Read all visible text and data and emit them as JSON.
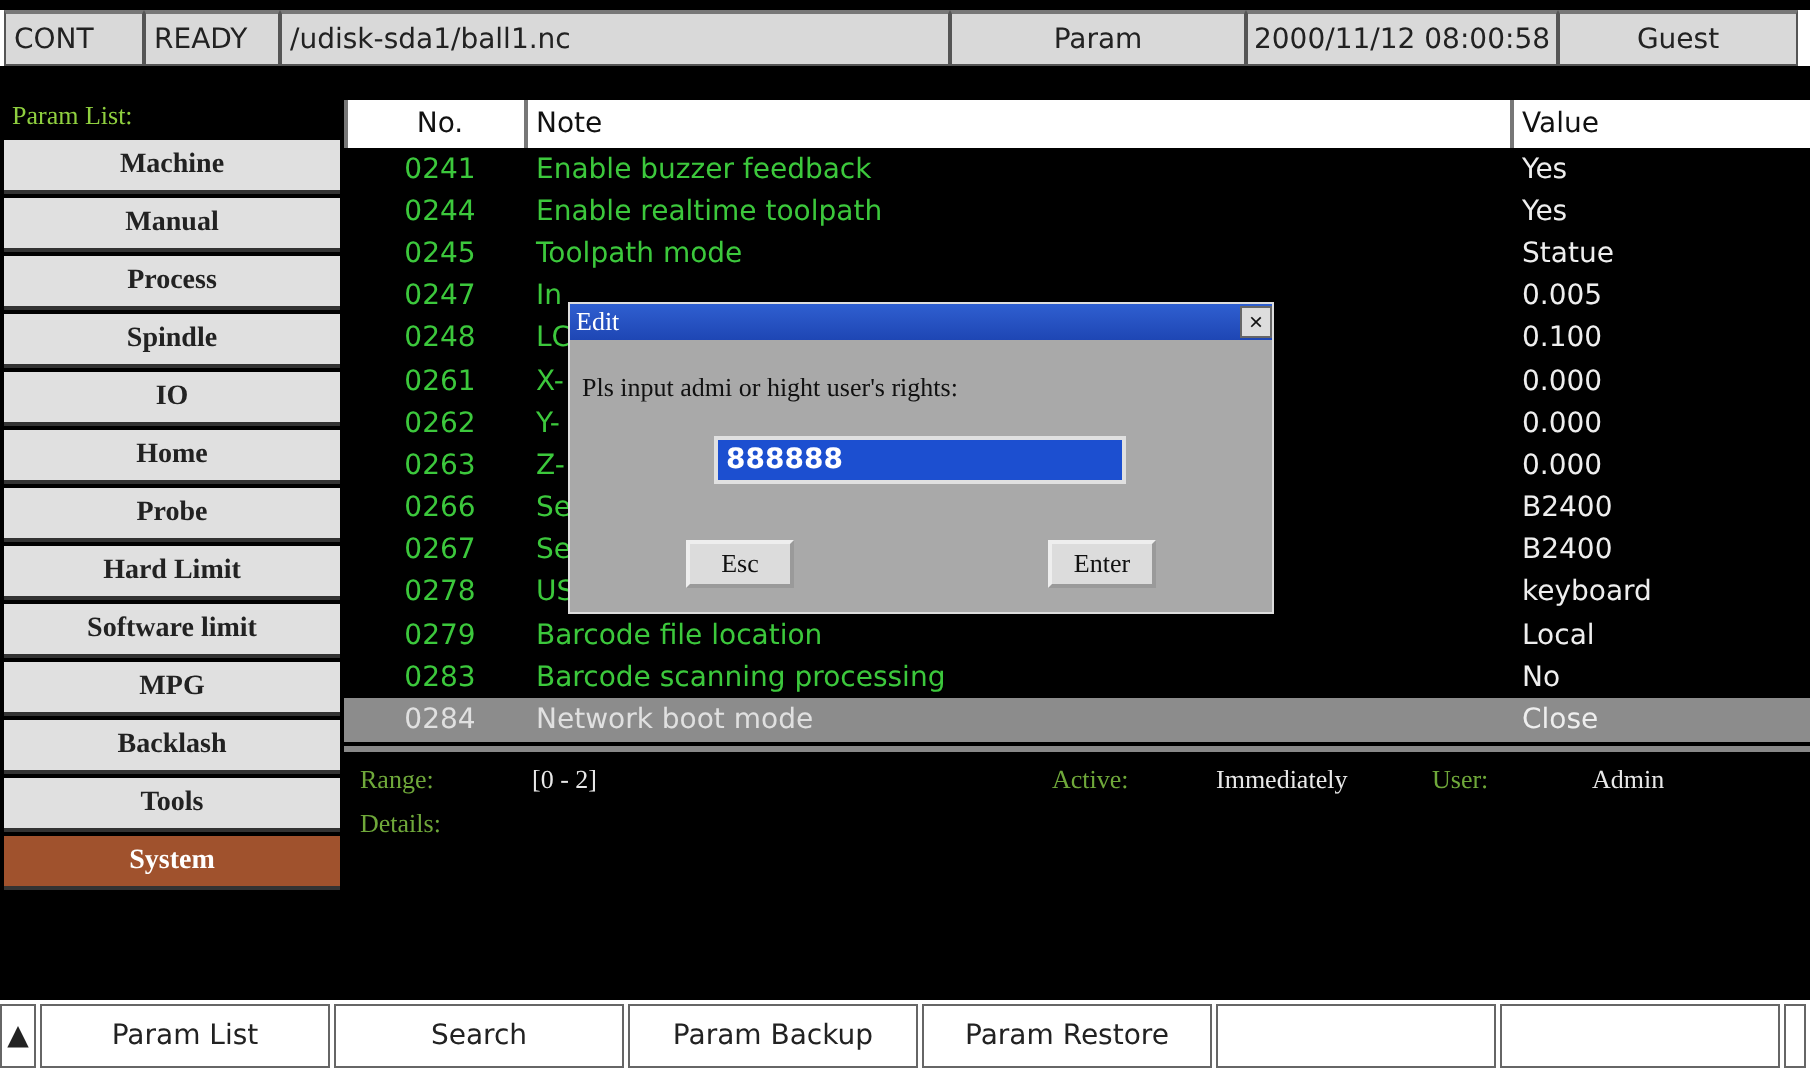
{
  "status_bar": [
    "CONT",
    "READY",
    "/udisk-sda1/ball1.nc",
    "Param",
    "2000/11/12 08:00:58",
    "Guest"
  ],
  "sidebar": {
    "title": "Param List:",
    "items": [
      {
        "label": "Machine",
        "selected": false
      },
      {
        "label": "Manual",
        "selected": false
      },
      {
        "label": "Process",
        "selected": false
      },
      {
        "label": "Spindle",
        "selected": false
      },
      {
        "label": "IO",
        "selected": false
      },
      {
        "label": "Home",
        "selected": false
      },
      {
        "label": "Probe",
        "selected": false
      },
      {
        "label": "Hard Limit",
        "selected": false
      },
      {
        "label": "Software limit",
        "selected": false
      },
      {
        "label": "MPG",
        "selected": false
      },
      {
        "label": "Backlash",
        "selected": false
      },
      {
        "label": "Tools",
        "selected": false
      },
      {
        "label": "System",
        "selected": true
      }
    ]
  },
  "table": {
    "columns": [
      "No.",
      "Note",
      "Value"
    ],
    "rows": [
      {
        "no": "0241",
        "note": "Enable buzzer feedback",
        "value": "Yes",
        "selected": false
      },
      {
        "no": "0244",
        "note": "Enable realtime toolpath",
        "value": "Yes",
        "selected": false
      },
      {
        "no": "0245",
        "note": "Toolpath mode",
        "value": "Statue",
        "selected": false
      },
      {
        "no": "0247",
        "note": "In",
        "value": "0.005",
        "selected": false
      },
      {
        "no": "0248",
        "note": "LC",
        "value": "0.100",
        "selected": false
      },
      {
        "no": "0261",
        "note": "X-",
        "value": "0.000",
        "selected": false
      },
      {
        "no": "0262",
        "note": "Y-",
        "value": "0.000",
        "selected": false
      },
      {
        "no": "0263",
        "note": "Z-",
        "value": "0.000",
        "selected": false
      },
      {
        "no": "0266",
        "note": "Se",
        "value": "B2400",
        "selected": false
      },
      {
        "no": "0267",
        "note": "Se",
        "value": "B2400",
        "selected": false
      },
      {
        "no": "0278",
        "note": "US",
        "value": "keyboard",
        "selected": false
      },
      {
        "no": "0279",
        "note": "Barcode file location",
        "value": "Local",
        "selected": false
      },
      {
        "no": "0283",
        "note": "Barcode scanning processing",
        "value": "No",
        "selected": false
      },
      {
        "no": "0284",
        "note": "Network boot mode",
        "value": "Close",
        "selected": true
      }
    ]
  },
  "details": {
    "range_label": "Range:",
    "range": "[0 - 2]",
    "active_label": "Active:",
    "active": "Immediately",
    "user_label": "User:",
    "user": "Admin",
    "details_label": "Details:"
  },
  "dialog": {
    "title": "Edit",
    "close": "×",
    "prompt": "Pls input admi or hight user's rights:",
    "value": "888888",
    "buttons": [
      "Esc",
      "Enter"
    ]
  },
  "softkeys": [
    {
      "kind": "arrow",
      "label": "▲"
    },
    {
      "kind": "key",
      "label": "Param List"
    },
    {
      "kind": "key",
      "label": "Search"
    },
    {
      "kind": "key",
      "label": "Param Backup"
    },
    {
      "kind": "key",
      "label": "Param Restore"
    },
    {
      "kind": "blank"
    },
    {
      "kind": "blank"
    },
    {
      "kind": "edge"
    }
  ]
}
